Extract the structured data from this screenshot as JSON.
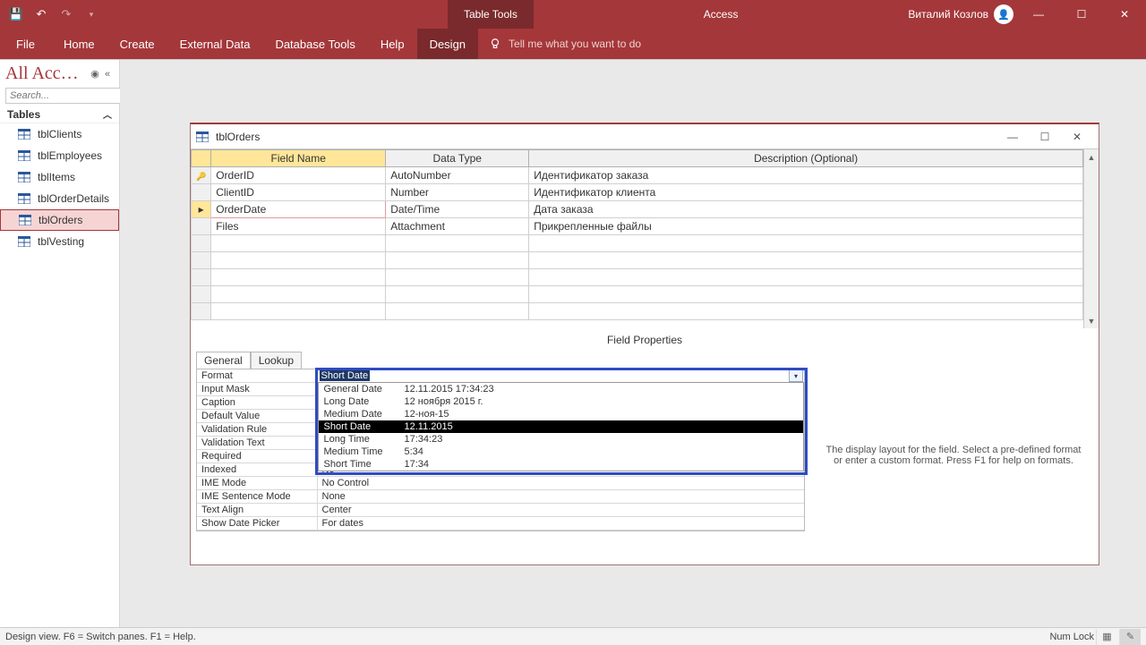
{
  "titlebar": {
    "table_tools": "Table Tools",
    "app_name": "Access",
    "user_name": "Виталий Козлов"
  },
  "ribbon": {
    "file": "File",
    "home": "Home",
    "create": "Create",
    "external_data": "External Data",
    "db_tools": "Database Tools",
    "help": "Help",
    "design": "Design",
    "tell_me": "Tell me what you want to do"
  },
  "nav": {
    "title": "All Acc…",
    "search_placeholder": "Search...",
    "group": "Tables",
    "items": [
      {
        "label": "tblClients"
      },
      {
        "label": "tblEmployees"
      },
      {
        "label": "tblItems"
      },
      {
        "label": "tblOrderDetails"
      },
      {
        "label": "tblOrders"
      },
      {
        "label": "tblVesting"
      }
    ]
  },
  "design_window": {
    "caption": "tblOrders",
    "cols": {
      "field": "Field Name",
      "type": "Data Type",
      "desc": "Description (Optional)"
    },
    "rows": [
      {
        "pk": true,
        "field": "OrderID",
        "type": "AutoNumber",
        "desc": "Идентификатор заказа"
      },
      {
        "pk": false,
        "field": "ClientID",
        "type": "Number",
        "desc": "Идентификатор клиента"
      },
      {
        "pk": false,
        "field": "OrderDate",
        "type": "Date/Time",
        "desc": "Дата заказа",
        "current": true
      },
      {
        "pk": false,
        "field": "Files",
        "type": "Attachment",
        "desc": "Прикрепленные файлы"
      }
    ],
    "field_properties_label": "Field Properties"
  },
  "props": {
    "tabs": {
      "general": "General",
      "lookup": "Lookup"
    },
    "rows": [
      {
        "name": "Format",
        "value": "Short Date",
        "editing": true
      },
      {
        "name": "Input Mask",
        "value": ""
      },
      {
        "name": "Caption",
        "value": ""
      },
      {
        "name": "Default Value",
        "value": ""
      },
      {
        "name": "Validation Rule",
        "value": ""
      },
      {
        "name": "Validation Text",
        "value": ""
      },
      {
        "name": "Required",
        "value": ""
      },
      {
        "name": "Indexed",
        "value": "No"
      },
      {
        "name": "IME Mode",
        "value": "No Control"
      },
      {
        "name": "IME Sentence Mode",
        "value": "None"
      },
      {
        "name": "Text Align",
        "value": "Center"
      },
      {
        "name": "Show Date Picker",
        "value": "For dates"
      }
    ],
    "dropdown": [
      {
        "name": "General Date",
        "sample": "12.11.2015 17:34:23"
      },
      {
        "name": "Long Date",
        "sample": "12 ноября 2015 г."
      },
      {
        "name": "Medium Date",
        "sample": "12-ноя-15"
      },
      {
        "name": "Short Date",
        "sample": "12.11.2015",
        "selected": true
      },
      {
        "name": "Long Time",
        "sample": "17:34:23"
      },
      {
        "name": "Medium Time",
        "sample": "5:34"
      },
      {
        "name": "Short Time",
        "sample": "17:34"
      }
    ],
    "help": "The display layout for the field. Select a pre-defined format or enter a custom format. Press F1 for help on formats."
  },
  "statusbar": {
    "left": "Design view.  F6 = Switch panes.  F1 = Help.",
    "numlock": "Num Lock"
  }
}
